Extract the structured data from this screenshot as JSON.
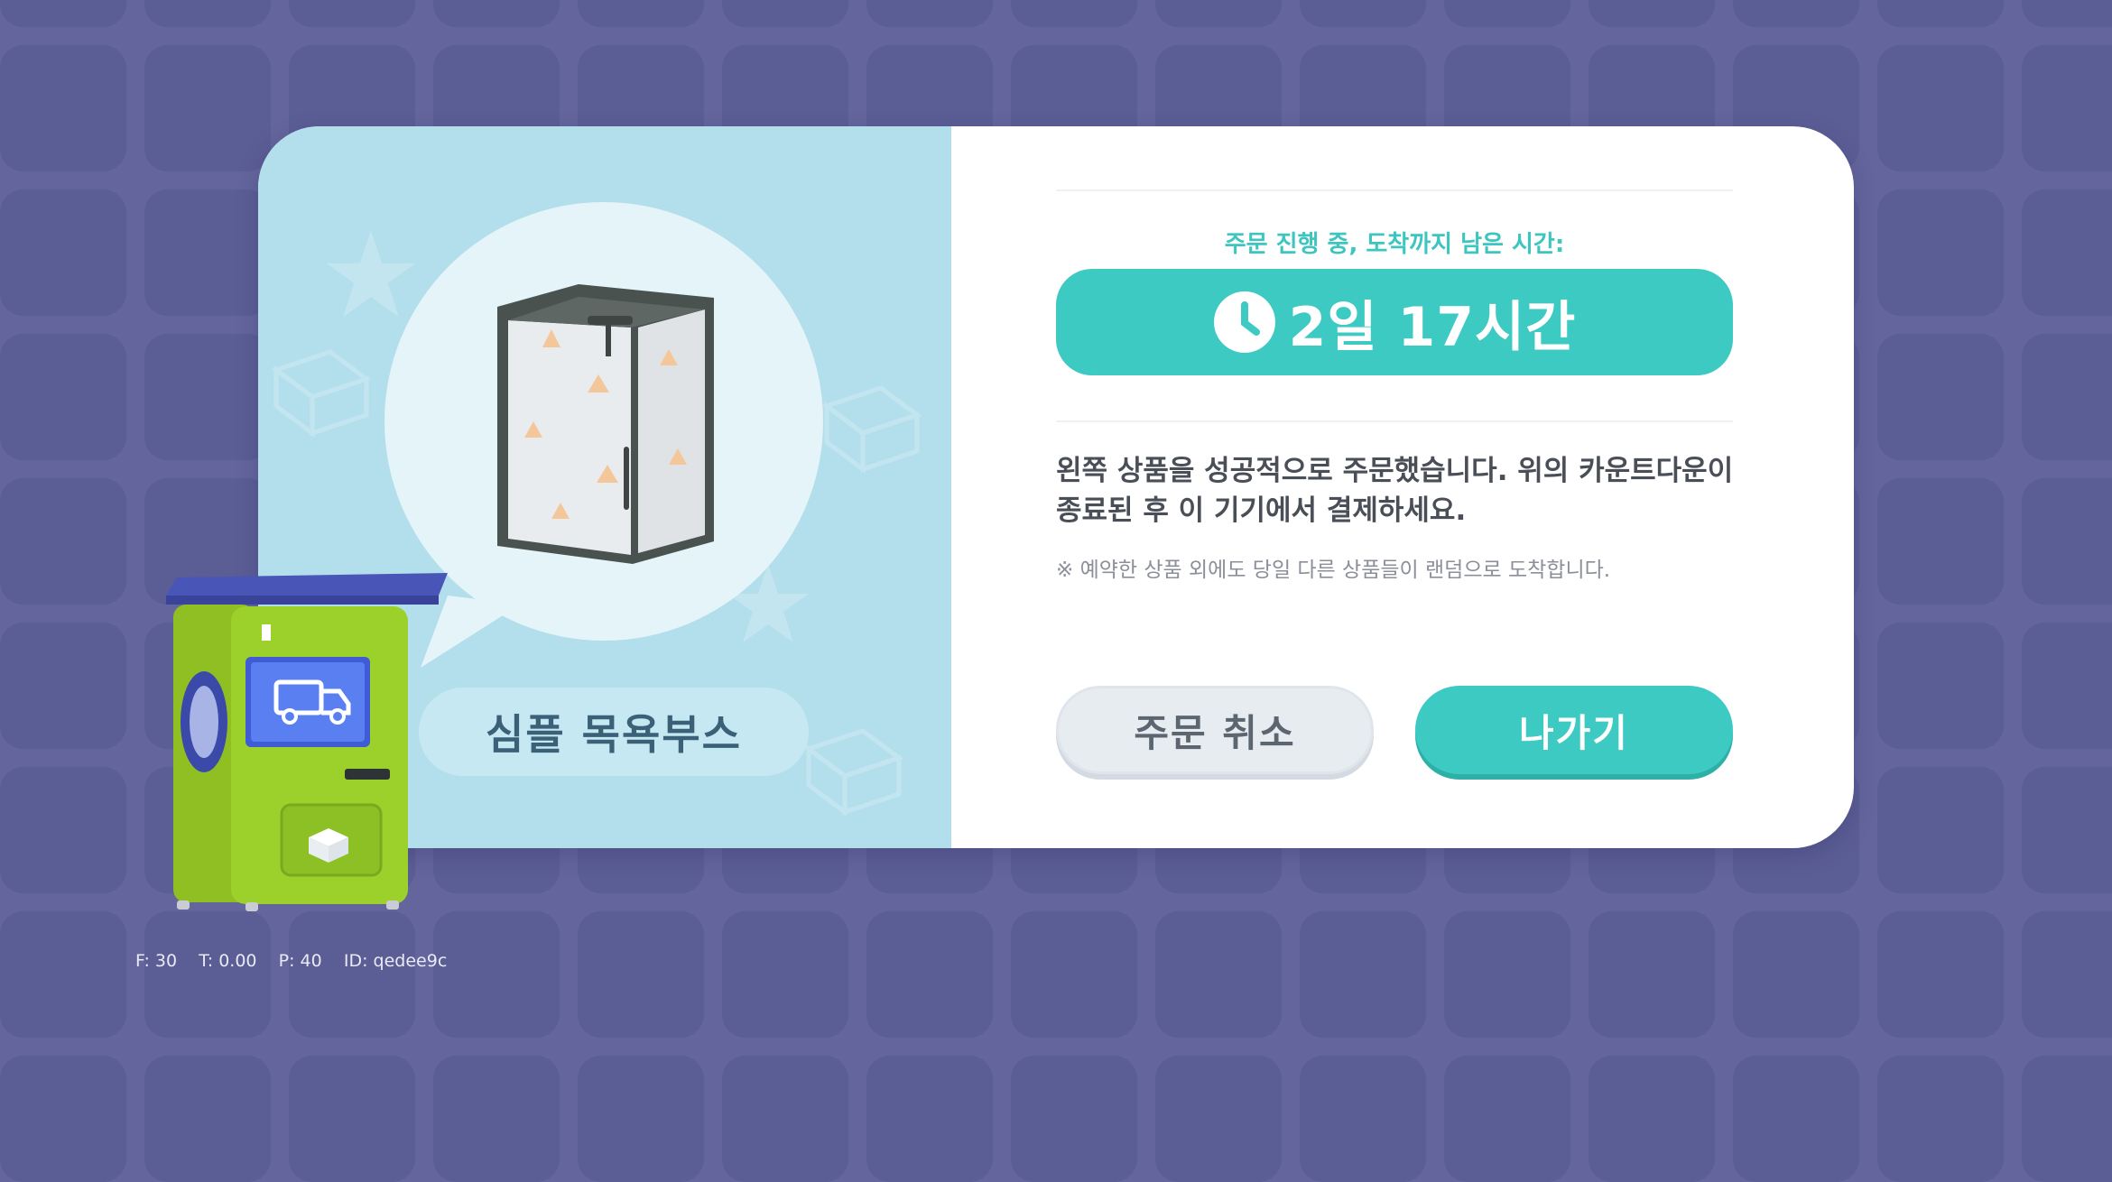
{
  "product": {
    "name": "심플 목욕부스"
  },
  "order": {
    "status_label": "주문 진행 중, 도착까지 남은 시간:",
    "countdown": "2일 17시간",
    "message_line1": "왼쪽 상품을 성공적으로 주문했습니다. 위의 카운트다운이",
    "message_line2": "종료된 후 이 기기에서 결제하세요.",
    "note": "※ 예약한 상품 외에도 당일 다른 상품들이 랜덤으로 도착합니다."
  },
  "buttons": {
    "cancel_label": "주문 취소",
    "exit_label": "나가기"
  },
  "debug": {
    "text": "F: 30    T: 0.00    P: 40    ID: qedee9c"
  },
  "icons": [
    "clock-icon",
    "truck-icon",
    "package-icon",
    "bath-booth-icon"
  ],
  "colors": {
    "accent": "#3ccac2",
    "background": "#63659c",
    "left_panel": "#b3dfec"
  }
}
